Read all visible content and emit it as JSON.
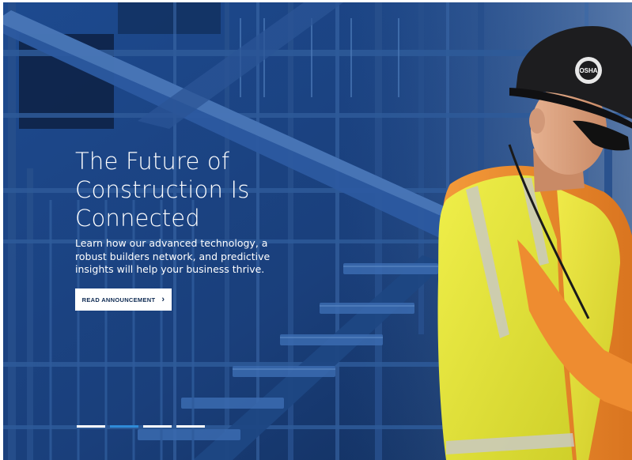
{
  "hero": {
    "headline_lines": [
      "The Future of",
      "Construction Is",
      "Connected"
    ],
    "subcopy": "Learn how our advanced technology, a robust builders network, and predictive insights will help your business thrive.",
    "cta_label": "READ ANNOUNCEMENT",
    "cta_icon": "chevron-right-icon",
    "cta_glyph": "›",
    "image_subject": "construction worker in hard hat and high-visibility vest beside steel stairs",
    "hardhat_badge": "OSHA"
  },
  "carousel": {
    "slide_count": 4,
    "active_index": 1
  },
  "colors": {
    "overlay_blue": "#1b3f7a",
    "cta_text": "#0e2a52",
    "indicator_active": "#2f8bd8",
    "indicator_inactive": "#ffffff",
    "vest_yellow": "#e6e534",
    "shirt_orange": "#f08a2c"
  }
}
